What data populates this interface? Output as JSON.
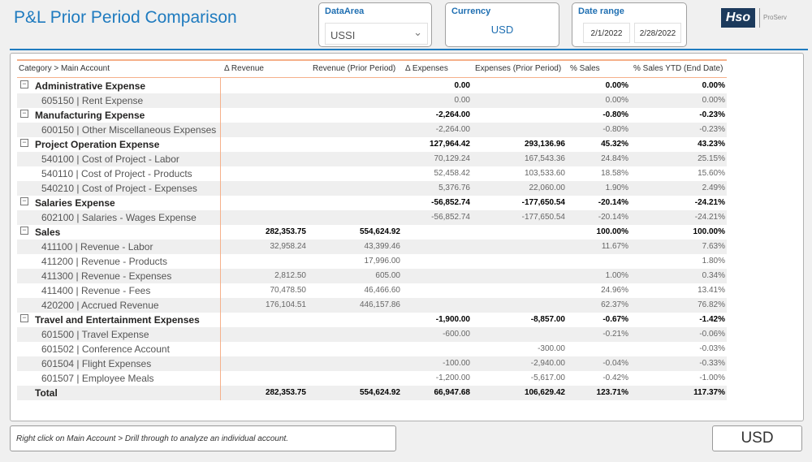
{
  "header": {
    "title": "P&L Prior Period Comparison",
    "logo_text": "Hso",
    "logo_sub": "ProServ"
  },
  "filters": {
    "dataarea_label": "DataArea",
    "dataarea_value": "USSI",
    "currency_label": "Currency",
    "currency_value": "USD",
    "date_label": "Date range",
    "date_start": "2/1/2022",
    "date_end": "2/28/2022"
  },
  "table": {
    "columns": [
      "Category > Main Account",
      "Δ Revenue",
      "Revenue (Prior Period)",
      "Δ Expenses",
      "Expenses (Prior Period)",
      "% Sales",
      "% Sales YTD (End Date)"
    ],
    "rows": [
      {
        "type": "cat",
        "label": "Administrative Expense",
        "v": [
          "",
          "",
          "0.00",
          "",
          "0.00%",
          "0.00%"
        ]
      },
      {
        "type": "acc",
        "label": "605150 | Rent Expense",
        "v": [
          "",
          "",
          "0.00",
          "",
          "0.00%",
          "0.00%"
        ]
      },
      {
        "type": "cat",
        "label": "Manufacturing Expense",
        "v": [
          "",
          "",
          "-2,264.00",
          "",
          "-0.80%",
          "-0.23%"
        ]
      },
      {
        "type": "acc",
        "label": "600150 | Other Miscellaneous Expenses",
        "v": [
          "",
          "",
          "-2,264.00",
          "",
          "-0.80%",
          "-0.23%"
        ]
      },
      {
        "type": "cat",
        "label": "Project Operation Expense",
        "v": [
          "",
          "",
          "127,964.42",
          "293,136.96",
          "45.32%",
          "43.23%"
        ]
      },
      {
        "type": "acc",
        "label": "540100 | Cost of Project - Labor",
        "v": [
          "",
          "",
          "70,129.24",
          "167,543.36",
          "24.84%",
          "25.15%"
        ]
      },
      {
        "type": "acc",
        "label": "540110 | Cost of Project - Products",
        "v": [
          "",
          "",
          "52,458.42",
          "103,533.60",
          "18.58%",
          "15.60%"
        ]
      },
      {
        "type": "acc",
        "label": "540210 | Cost of Project - Expenses",
        "v": [
          "",
          "",
          "5,376.76",
          "22,060.00",
          "1.90%",
          "2.49%"
        ]
      },
      {
        "type": "cat",
        "label": "Salaries Expense",
        "v": [
          "",
          "",
          "-56,852.74",
          "-177,650.54",
          "-20.14%",
          "-24.21%"
        ]
      },
      {
        "type": "acc",
        "label": "602100 | Salaries - Wages Expense",
        "v": [
          "",
          "",
          "-56,852.74",
          "-177,650.54",
          "-20.14%",
          "-24.21%"
        ]
      },
      {
        "type": "cat",
        "label": "Sales",
        "v": [
          "282,353.75",
          "554,624.92",
          "",
          "",
          "100.00%",
          "100.00%"
        ]
      },
      {
        "type": "acc",
        "label": "411100 | Revenue - Labor",
        "v": [
          "32,958.24",
          "43,399.46",
          "",
          "",
          "11.67%",
          "7.63%"
        ]
      },
      {
        "type": "acc",
        "label": "411200 | Revenue - Products",
        "v": [
          "",
          "17,996.00",
          "",
          "",
          "",
          "1.80%"
        ]
      },
      {
        "type": "acc",
        "label": "411300 | Revenue - Expenses",
        "v": [
          "2,812.50",
          "605.00",
          "",
          "",
          "1.00%",
          "0.34%"
        ]
      },
      {
        "type": "acc",
        "label": "411400 | Revenue - Fees",
        "v": [
          "70,478.50",
          "46,466.60",
          "",
          "",
          "24.96%",
          "13.41%"
        ]
      },
      {
        "type": "acc",
        "label": "420200 | Accrued Revenue",
        "v": [
          "176,104.51",
          "446,157.86",
          "",
          "",
          "62.37%",
          "76.82%"
        ]
      },
      {
        "type": "cat",
        "label": "Travel and Entertainment Expenses",
        "v": [
          "",
          "",
          "-1,900.00",
          "-8,857.00",
          "-0.67%",
          "-1.42%"
        ]
      },
      {
        "type": "acc",
        "label": "601500 | Travel Expense",
        "v": [
          "",
          "",
          "-600.00",
          "",
          "-0.21%",
          "-0.06%"
        ]
      },
      {
        "type": "acc",
        "label": "601502 | Conference Account",
        "v": [
          "",
          "",
          "",
          "-300.00",
          "",
          "-0.03%"
        ]
      },
      {
        "type": "acc",
        "label": "601504 | Flight Expenses",
        "v": [
          "",
          "",
          "-100.00",
          "-2,940.00",
          "-0.04%",
          "-0.33%"
        ]
      },
      {
        "type": "acc",
        "label": "601507 | Employee Meals",
        "v": [
          "",
          "",
          "-1,200.00",
          "-5,617.00",
          "-0.42%",
          "-1.00%"
        ]
      },
      {
        "type": "tot",
        "label": "Total",
        "v": [
          "282,353.75",
          "554,624.92",
          "66,947.68",
          "106,629.42",
          "123.71%",
          "117.37%"
        ]
      }
    ]
  },
  "footer": {
    "note": "Right click on Main Account > Drill through to analyze an individual account.",
    "currency_card": "USD"
  },
  "colors": {
    "accent": "#1f7bbf",
    "header_rule": "#f5b08a"
  }
}
